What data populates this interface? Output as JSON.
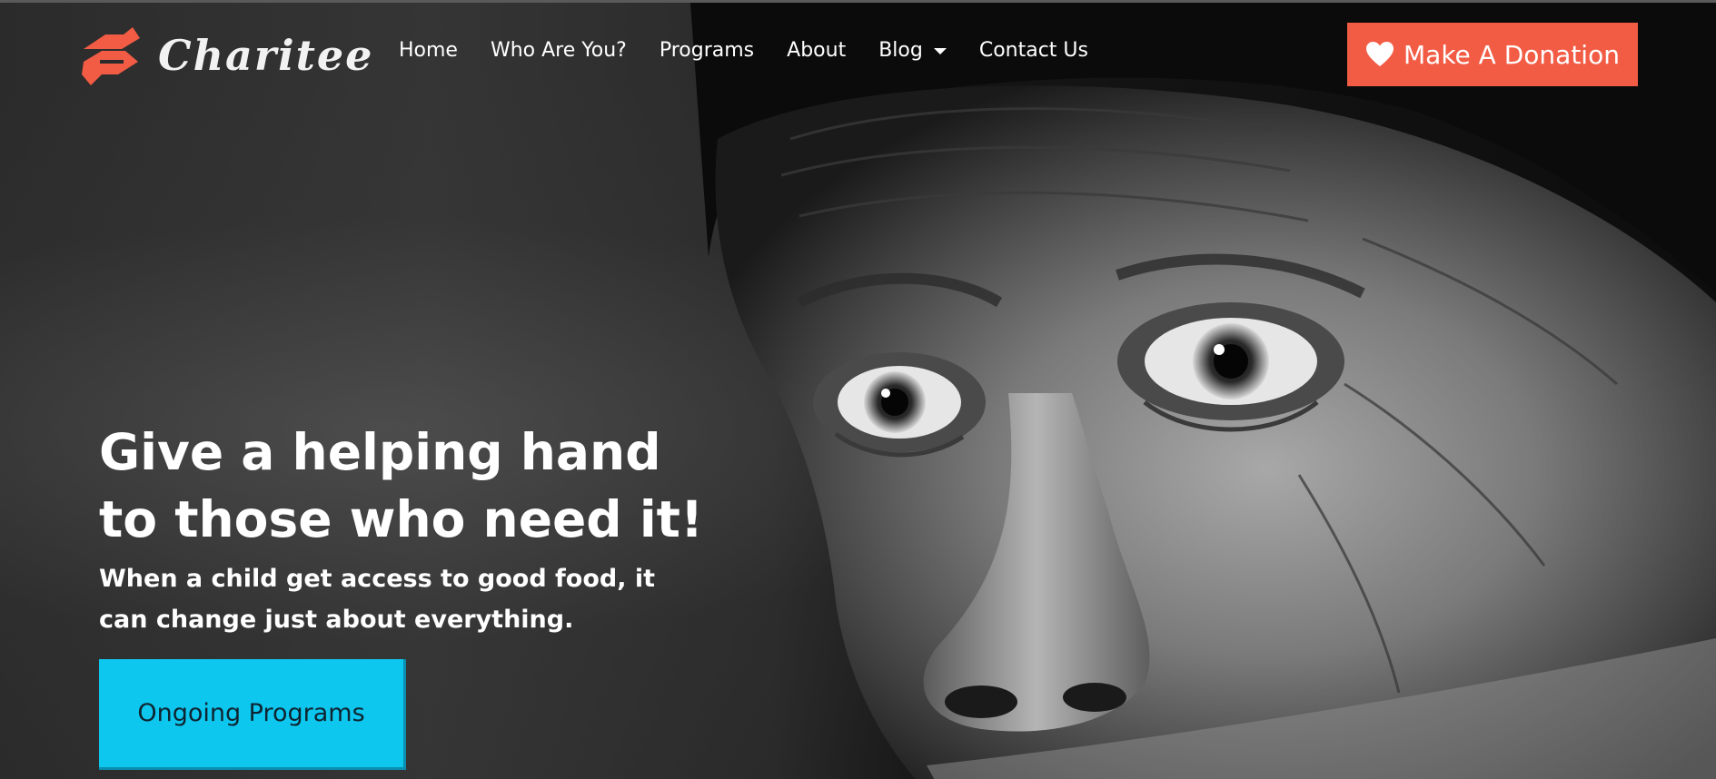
{
  "brand": {
    "name": "Charitee",
    "accent_color": "#f25c45",
    "cta_color": "#0dc7ef",
    "logo_icon": "helping-hands-logo-icon"
  },
  "nav": {
    "items": [
      {
        "label": "Home"
      },
      {
        "label": "Who Are You?"
      },
      {
        "label": "Programs"
      },
      {
        "label": "About"
      },
      {
        "label": "Blog",
        "has_dropdown": true
      },
      {
        "label": "Contact Us"
      }
    ]
  },
  "donate": {
    "label": "Make A Donation",
    "icon": "heart-icon"
  },
  "hero": {
    "title": "Give a helping hand to those who need it!",
    "subtitle": "When a child get access to good food, it can change just about everything.",
    "cta_label": "Ongoing Programs"
  }
}
